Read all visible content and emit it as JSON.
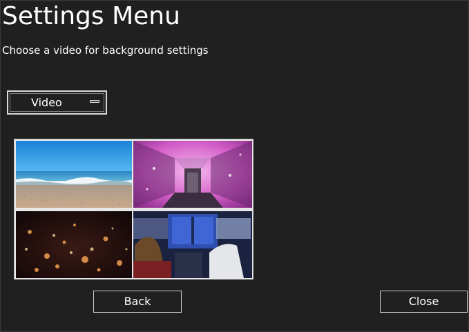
{
  "header": {
    "title": "Settings Menu",
    "subtitle": "Choose a video for background settings"
  },
  "dropdown": {
    "selected": "Video",
    "indicator_icon": "dropdown-indicator-icon"
  },
  "thumbnails": [
    {
      "name": "beach-thumbnail"
    },
    {
      "name": "pink-spaceship-corridor-thumbnail"
    },
    {
      "name": "bokeh-lights-thumbnail"
    },
    {
      "name": "cockpit-thumbnail"
    }
  ],
  "buttons": {
    "back": "Back",
    "close": "Close"
  },
  "colors": {
    "background": "#202020",
    "text": "#ffffff",
    "border": "#d0d0d0"
  }
}
